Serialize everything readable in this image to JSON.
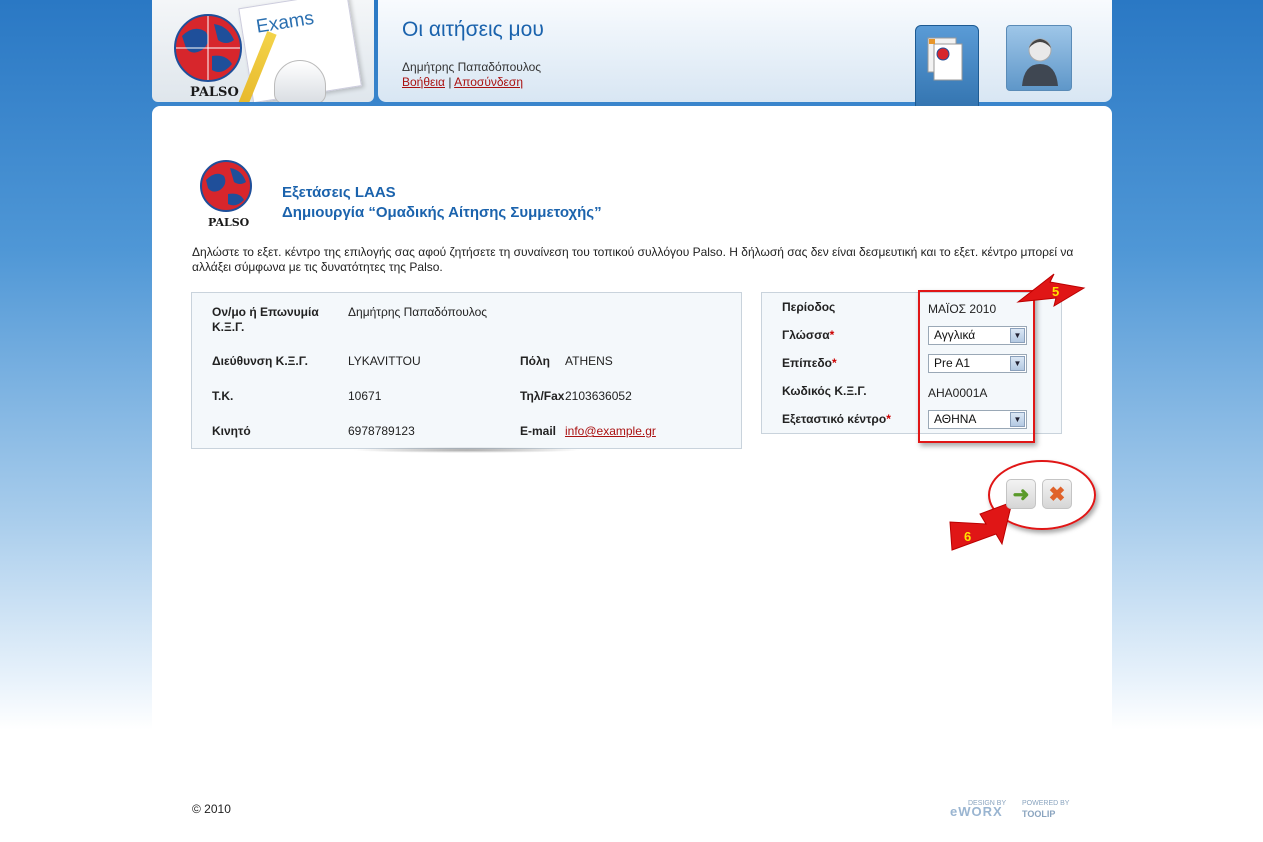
{
  "header": {
    "logo_text": "PALSO",
    "exams_label": "Exams",
    "page_title": "Οι αιτήσεις μου",
    "user_name": "Δημήτρης Παπαδόπουλος",
    "help_link": "Βοήθεια",
    "separator": "|",
    "logout_link": "Αποσύνδεση",
    "tabs": [
      {
        "name": "applications",
        "icon": "documents-icon",
        "active": true
      },
      {
        "name": "profile",
        "icon": "user-icon",
        "active": false
      }
    ]
  },
  "exam": {
    "logo_text": "PALSO",
    "title": "Εξετάσεις LAAS",
    "subtitle": "Δημιουργία “Ομαδικής Αίτησης Συμμετοχής”",
    "intro": "Δηλώστε το εξετ. κέντρο της επιλογής σας αφού ζητήσετε τη συναίνεση του τοπικού συλλόγου Palso. Η δήλωσή σας δεν είναι δεσμευτική και το εξετ. κέντρο μπορεί να αλλάξει σύμφωνα με τις δυνατότητες της Palso."
  },
  "info": {
    "name_label": "Ον/μο ή Επωνυμία Κ.Ξ.Γ.",
    "name_value": "Δημήτρης Παπαδόπουλος",
    "address_label": "Διεύθυνση Κ.Ξ.Γ.",
    "address_value": "LYKAVITTOU",
    "city_label": "Πόλη",
    "city_value": "ATHENS",
    "zip_label": "Τ.Κ.",
    "zip_value": "10671",
    "phone_label": "Τηλ/Fax",
    "phone_value": "2103636052",
    "mobile_label": "Κινητό",
    "mobile_value": "6978789123",
    "email_label": "E-mail",
    "email_value": "info@example.gr"
  },
  "form": {
    "period_label": "Περίοδος",
    "period_value": "ΜΑΪΟΣ 2010",
    "language_label": "Γλώσσα",
    "language_value": "Αγγλικά",
    "level_label": "Επίπεδο",
    "level_value": "Pre A1",
    "code_label": "Κωδικός Κ.Ξ.Γ.",
    "code_value": "AHA0001A",
    "center_label": "Εξεταστικό κέντρο",
    "center_value": "ΑΘΗΝΑ",
    "required_mark": "*"
  },
  "annotations": {
    "callout_5": "5",
    "callout_6": "6",
    "highlight_color": "#e01616"
  },
  "actions": {
    "submit_icon": "arrow-right-icon",
    "cancel_icon": "close-icon",
    "submit_glyph": "➜",
    "cancel_glyph": "✖"
  },
  "footer": {
    "copyright": "© 2010",
    "design_by": "DESIGN BY",
    "designer": "eWORX",
    "powered_by": "POWERED BY",
    "platform": "TOOLIP"
  }
}
